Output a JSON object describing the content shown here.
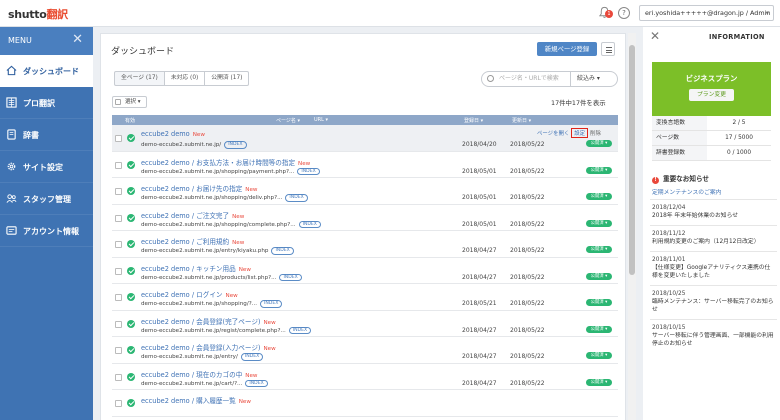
{
  "header": {
    "logo_main": "shutto",
    "logo_accent": "翻訳",
    "notification_count": "1",
    "help_icon": "?",
    "account": "eri.yoshida+++++@dragon.jp / Admin",
    "account_caret": "▾"
  },
  "sidebar": {
    "menu_label": "MENU",
    "close_glyph": "✕",
    "items": [
      {
        "label": "ダッシュボード",
        "icon": "home-icon",
        "active": true
      },
      {
        "label": "プロ翻訳",
        "icon": "translation-icon",
        "active": false
      },
      {
        "label": "辞書",
        "icon": "dictionary-icon",
        "active": false
      },
      {
        "label": "サイト設定",
        "icon": "gear-icon",
        "active": false
      },
      {
        "label": "スタッフ管理",
        "icon": "users-icon",
        "active": false
      },
      {
        "label": "アカウント情報",
        "icon": "account-icon",
        "active": false
      }
    ]
  },
  "main": {
    "title": "ダッシュボード",
    "new_page_button": "新規ページ登録",
    "tabs": [
      "全ページ (17)",
      "未対応 (0)",
      "公開済 (17)"
    ],
    "search_placeholder": "ページ名・URLで検索",
    "filter_label": "絞込み ▾",
    "select_label": "選択 ▾",
    "count_text": "17件中17件を表示",
    "columns": {
      "status": "有効",
      "page_name": "ページ名 ▾",
      "url": "URL ▾",
      "registered": "登録日 ▾",
      "updated": "更新日 ▾"
    },
    "row_actions": {
      "view": "ページを開く",
      "settings": "設定",
      "delete": "削除"
    },
    "new_badge": "New",
    "index_badge": "INDEX",
    "published_label": "公開済 ▾",
    "rows": [
      {
        "name": "eccube2 demo",
        "url": "demo-eccube2.submit.ne.jp/",
        "registered": "2018/04/20",
        "updated": "2018/05/22"
      },
      {
        "name": "eccube2 demo / お支払方法・お届け時間等の指定",
        "url": "demo-eccube2.submit.ne.jp/shopping/payment.php?...",
        "registered": "2018/05/01",
        "updated": "2018/05/22"
      },
      {
        "name": "eccube2 demo / お届け先の指定",
        "url": "demo-eccube2.submit.ne.jp/shopping/deliv.php?...",
        "registered": "2018/05/01",
        "updated": "2018/05/22"
      },
      {
        "name": "eccube2 demo / ご注文完了",
        "url": "demo-eccube2.submit.ne.jp/shopping/complete.php?...",
        "registered": "2018/05/01",
        "updated": "2018/05/22"
      },
      {
        "name": "eccube2 demo / ご利用規約",
        "url": "demo-eccube2.submit.ne.jp/entry/kiyaku.php",
        "registered": "2018/04/27",
        "updated": "2018/05/22"
      },
      {
        "name": "eccube2 demo / キッチン用品",
        "url": "demo-eccube2.submit.ne.jp/products/list.php?...",
        "registered": "2018/04/27",
        "updated": "2018/05/22"
      },
      {
        "name": "eccube2 demo / ログイン",
        "url": "demo-eccube2.submit.ne.jp/shopping/?...",
        "registered": "2018/05/21",
        "updated": "2018/05/22"
      },
      {
        "name": "eccube2 demo / 会員登録(完了ページ)",
        "url": "demo-eccube2.submit.ne.jp/regist/complete.php?...",
        "registered": "2018/04/27",
        "updated": "2018/05/22"
      },
      {
        "name": "eccube2 demo / 会員登録(入力ページ)",
        "url": "demo-eccube2.submit.ne.jp/entry/",
        "registered": "2018/04/27",
        "updated": "2018/05/22"
      },
      {
        "name": "eccube2 demo / 現在のカゴの中",
        "url": "demo-eccube2.submit.ne.jp/cart/?...",
        "registered": "2018/04/27",
        "updated": "2018/05/22"
      },
      {
        "name": "eccube2 demo / 購入履歴一覧",
        "url": "",
        "registered": "",
        "updated": ""
      }
    ]
  },
  "info": {
    "close_glyph": "✕",
    "title": "INFORMATION",
    "plan_name": "ビジネスプラン",
    "plan_button": "プラン変更",
    "stats": [
      {
        "label": "変換言語数",
        "value": "2 / 5"
      },
      {
        "label": "ページ数",
        "value": "17 / 5000"
      },
      {
        "label": "辞書登録数",
        "value": "0 / 1000"
      }
    ],
    "notice_heading": "重要なお知らせ",
    "notice_dot": "!",
    "maintenance_link": "定期メンテナンスのご案内",
    "news": [
      {
        "date": "2018/12/04",
        "text": "2018年 年末年始休業のお知らせ"
      },
      {
        "date": "2018/11/12",
        "text": "利用規約変更のご案内（12月12日改定）"
      },
      {
        "date": "2018/11/01",
        "text": "【仕様変更】Googleアナリティクス連携の仕様を変更いたしました"
      },
      {
        "date": "2018/10/25",
        "text": "臨時メンテナンス：サーバー移転完了のお知らせ"
      },
      {
        "date": "2018/10/15",
        "text": "サーバー移転に伴う管理画面、一部機能の利用停止のお知らせ"
      }
    ]
  },
  "colors": {
    "sidebar": "#3f73b3",
    "accent_blue": "#4f86c6",
    "published_green": "#2bb673",
    "plan_green": "#7cbf28",
    "new_red": "#e9483b",
    "highlight_red_border": "#e0251a"
  }
}
